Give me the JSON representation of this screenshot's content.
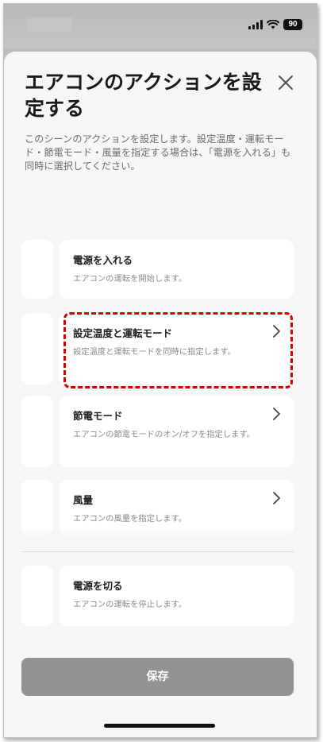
{
  "status_bar": {
    "battery": "90"
  },
  "sheet": {
    "title": "エアコンのアクションを設定する",
    "description": "このシーンのアクションを設定します。設定温度・運転モード・節電モード・風量を指定する場合は、「電源を入れる」も同時に選択してください。"
  },
  "actions": [
    {
      "title": "電源を入れる",
      "description": "エアコンの運転を開始します。"
    },
    {
      "title": "設定温度と運転モード",
      "description": "設定温度と運転モードを同時に指定します。"
    },
    {
      "title": "節電モード",
      "description": "エアコンの節電モードのオン/オフを指定します。"
    },
    {
      "title": "風量",
      "description": "エアコンの風量を指定します。"
    },
    {
      "title": "電源を切る",
      "description": "エアコンの運転を停止します。"
    }
  ],
  "save_button": {
    "label": "保存"
  },
  "colors": {
    "highlight": "#d40000",
    "save_button": "#939393",
    "sheet_background": "#f6f6f6"
  }
}
